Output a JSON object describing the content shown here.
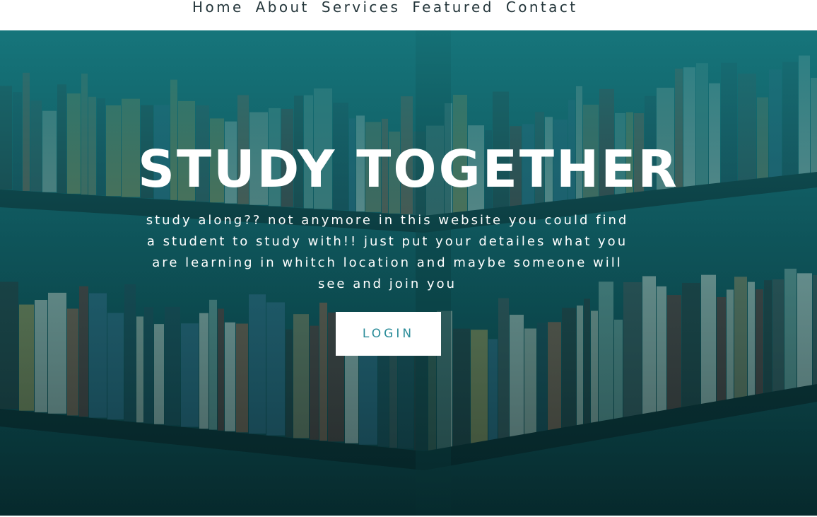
{
  "nav": {
    "items": [
      {
        "label": "Home"
      },
      {
        "label": "About"
      },
      {
        "label": "Services"
      },
      {
        "label": "Featured"
      },
      {
        "label": "Contact"
      }
    ]
  },
  "hero": {
    "title": "STUDY TOGETHER",
    "text": "study along?? not anymore in this website you could find a student to study with!! just put your detailes what you are learning in whitch location and maybe someone will see and join you",
    "login_label": "LOGIN"
  },
  "colors": {
    "nav_text": "#23353a",
    "hero_teal": "#166f75",
    "hero_dark": "#082e31",
    "button_text": "#2a8c99"
  }
}
